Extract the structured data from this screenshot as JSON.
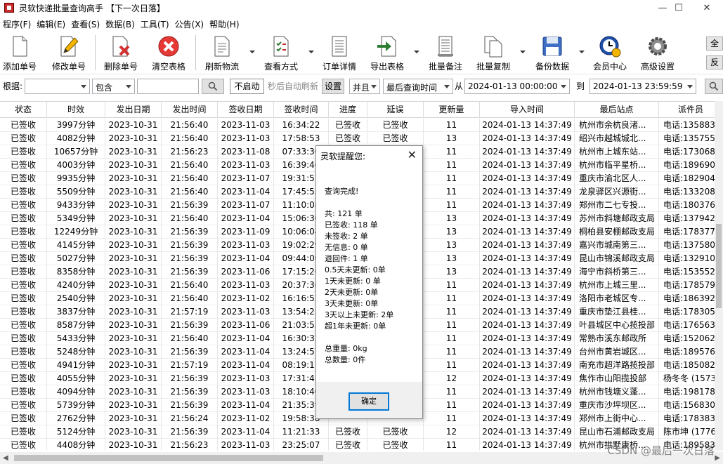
{
  "window": {
    "title": "灵软快递批量查询高手 【下一次日落】",
    "controls": [
      "—",
      "☐",
      "✕"
    ]
  },
  "menu": [
    "程序(F)",
    "编辑(E)",
    "查看(S)",
    "数据(B)",
    "工具(T)",
    "公告(X)",
    "帮助(H)"
  ],
  "toolbar": {
    "buttons": [
      {
        "label": "添加单号",
        "icon": "add-document-icon"
      },
      {
        "label": "修改单号",
        "icon": "edit-pencil-icon"
      },
      {
        "label": "删除单号",
        "icon": "delete-document-icon"
      },
      {
        "label": "清空表格",
        "icon": "clear-red-x-icon"
      },
      {
        "label": "刷新物流",
        "icon": "refresh-document-icon"
      },
      {
        "label": "查看方式",
        "icon": "view-mode-icon"
      },
      {
        "label": "订单详情",
        "icon": "order-detail-icon"
      },
      {
        "label": "导出表格",
        "icon": "export-arrow-icon"
      },
      {
        "label": "批量备注",
        "icon": "batch-note-icon"
      },
      {
        "label": "批量复制",
        "icon": "batch-copy-icon"
      },
      {
        "label": "备份数据",
        "icon": "floppy-disk-icon"
      },
      {
        "label": "会员中心",
        "icon": "clock-user-icon"
      },
      {
        "label": "高级设置",
        "icon": "gear-icon"
      }
    ],
    "side_buttons": [
      "全选",
      "反选"
    ]
  },
  "filter": {
    "label": "根据:",
    "field_value": "",
    "match_value": "包含",
    "search_value": "",
    "auto_refresh_button": "不启动",
    "auto_refresh_text": "秒后自动刷新",
    "settings_button": "设置",
    "logic_value": "并且",
    "time_field_value": "最后查询时间",
    "from_label": "从",
    "from_value": "2024-01-13 00:00:00",
    "to_label": "到",
    "to_value": "2024-01-13 23:59:59"
  },
  "table": {
    "columns": [
      "状态",
      "时效",
      "发出日期",
      "发出时间",
      "签收日期",
      "签收时间",
      "进度",
      "延误",
      "更新量",
      "导入时间",
      "最后站点",
      "派件员"
    ],
    "rows": [
      [
        "已签收",
        "3997分钟",
        "2023-10-31",
        "21:56:40",
        "2023-11-03",
        "16:34:22",
        "已签收",
        "已签收",
        "11",
        "2024-01-13 14:37:49",
        "杭州市余杭良渚...",
        "电话:1358836"
      ],
      [
        "已签收",
        "4082分钟",
        "2023-10-31",
        "21:56:40",
        "2023-11-03",
        "17:58:53",
        "已签收",
        "已签收",
        "13",
        "2024-01-13 14:37:49",
        "绍兴市越城城北...",
        "电话:1357558"
      ],
      [
        "已签收",
        "10657分钟",
        "2023-10-31",
        "21:56:23",
        "2023-11-08",
        "07:33:30",
        "",
        "",
        "11",
        "2024-01-13 14:37:49",
        "杭州市上城东站...",
        "电话:1730681"
      ],
      [
        "已签收",
        "4003分钟",
        "2023-10-31",
        "21:56:40",
        "2023-11-03",
        "16:39:46",
        "",
        "",
        "11",
        "2024-01-13 14:37:49",
        "杭州市临平星桥...",
        "电话:1896900"
      ],
      [
        "已签收",
        "9935分钟",
        "2023-10-31",
        "21:56:40",
        "2023-11-07",
        "19:31:57",
        "",
        "",
        "11",
        "2024-01-13 14:37:49",
        "重庆市渝北区人...",
        "电话:1829046"
      ],
      [
        "已签收",
        "5509分钟",
        "2023-10-31",
        "21:56:40",
        "2023-11-04",
        "17:45:55",
        "",
        "",
        "11",
        "2024-01-13 14:37:49",
        "龙泉驿区兴源街...",
        "电话:1332084"
      ],
      [
        "已签收",
        "9433分钟",
        "2023-10-31",
        "21:56:39",
        "2023-11-07",
        "11:10:08",
        "",
        "",
        "11",
        "2024-01-13 14:37:49",
        "郑州市二七专投...",
        "电话:1803768"
      ],
      [
        "已签收",
        "5349分钟",
        "2023-10-31",
        "21:56:40",
        "2023-11-04",
        "15:06:30",
        "",
        "",
        "13",
        "2024-01-13 14:37:49",
        "苏州市斜塘邮政支局",
        "电话:1379427"
      ],
      [
        "已签收",
        "12249分钟",
        "2023-10-31",
        "21:56:39",
        "2023-11-09",
        "10:06:04",
        "",
        "",
        "13",
        "2024-01-13 14:37:49",
        "桐柏县安棚邮政支局",
        "电话:1783775"
      ],
      [
        "已签收",
        "4145分钟",
        "2023-10-31",
        "21:56:39",
        "2023-11-03",
        "19:02:29",
        "",
        "",
        "13",
        "2024-01-13 14:37:49",
        "嘉兴市城南第三...",
        "电话:1375807"
      ],
      [
        "已签收",
        "5027分钟",
        "2023-10-31",
        "21:56:39",
        "2023-11-04",
        "09:44:00",
        "",
        "",
        "13",
        "2024-01-13 14:37:49",
        "昆山市锦溪邮政支局",
        "电话:1329109"
      ],
      [
        "已签收",
        "8358分钟",
        "2023-10-31",
        "21:56:39",
        "2023-11-06",
        "17:15:26",
        "",
        "",
        "13",
        "2024-01-13 14:37:49",
        "海宁市斜桥第三...",
        "电话:1535520"
      ],
      [
        "已签收",
        "4240分钟",
        "2023-10-31",
        "21:56:40",
        "2023-11-03",
        "20:37:36",
        "",
        "",
        "11",
        "2024-01-13 14:37:49",
        "杭州市上城三里...",
        "电话:1785790"
      ],
      [
        "已签收",
        "2540分钟",
        "2023-10-31",
        "21:56:40",
        "2023-11-02",
        "16:16:52",
        "",
        "",
        "11",
        "2024-01-13 14:37:49",
        "洛阳市老城区专...",
        "电话:1863929"
      ],
      [
        "已签收",
        "3837分钟",
        "2023-10-31",
        "21:57:19",
        "2023-11-03",
        "13:54:23",
        "",
        "",
        "11",
        "2024-01-13 14:37:49",
        "重庆市垫江县桂...",
        "电话:1783053"
      ],
      [
        "已签收",
        "8587分钟",
        "2023-10-31",
        "21:56:39",
        "2023-11-06",
        "21:03:53",
        "",
        "",
        "11",
        "2024-01-13 14:37:49",
        "叶县城区中心揽投部",
        "电话:1765633"
      ],
      [
        "已签收",
        "5433分钟",
        "2023-10-31",
        "21:56:40",
        "2023-11-04",
        "16:30:32",
        "",
        "",
        "11",
        "2024-01-13 14:37:49",
        "常熟市溪东邮政所",
        "电话:1520623"
      ],
      [
        "已签收",
        "5248分钟",
        "2023-10-31",
        "21:56:39",
        "2023-11-04",
        "13:24:57",
        "",
        "",
        "11",
        "2024-01-13 14:37:49",
        "台州市黄岩城区...",
        "电话:1895762"
      ],
      [
        "已签收",
        "4941分钟",
        "2023-10-31",
        "21:57:19",
        "2023-11-04",
        "08:19:11",
        "",
        "",
        "11",
        "2024-01-13 14:37:49",
        "南充市超洋路揽投部",
        "电话:1850821"
      ],
      [
        "已签收",
        "4055分钟",
        "2023-10-31",
        "21:56:39",
        "2023-11-03",
        "17:31:43",
        "",
        "",
        "12",
        "2024-01-13 14:37:49",
        "焦作市山阳揽投部",
        "杨冬冬 (1573"
      ],
      [
        "已签收",
        "4094分钟",
        "2023-10-31",
        "21:56:39",
        "2023-11-03",
        "18:10:40",
        "",
        "",
        "11",
        "2024-01-13 14:37:49",
        "杭州市钱塘义蓬...",
        "电话:1981785"
      ],
      [
        "已签收",
        "5739分钟",
        "2023-10-31",
        "21:56:39",
        "2023-11-04",
        "21:35:39",
        "",
        "",
        "11",
        "2024-01-13 14:37:49",
        "重庆市沙坪坝区...",
        "电话:1568308"
      ],
      [
        "已签收",
        "2762分钟",
        "2023-10-31",
        "21:56:24",
        "2023-11-02",
        "19:58:38",
        "",
        "",
        "11",
        "2024-01-13 14:37:49",
        "郑州市上街中心...",
        "电话:1783831"
      ],
      [
        "已签收",
        "5124分钟",
        "2023-10-31",
        "21:56:39",
        "2023-11-04",
        "11:21:33",
        "已签收",
        "已签收",
        "12",
        "2024-01-13 14:37:49",
        "昆山市石浦邮政支局",
        "陈市坤 (1776"
      ],
      [
        "已签收",
        "4408分钟",
        "2023-10-31",
        "21:56:23",
        "2023-11-03",
        "23:25:07",
        "已签收",
        "已签收",
        "11",
        "2024-01-13 14:37:49",
        "杭州市拱墅康桥...",
        "电话:1895837"
      ]
    ]
  },
  "dialog": {
    "title": "灵软提醒您:",
    "lines": [
      "查询完成!",
      "",
      "共: 121 单",
      "已签收: 118 单",
      "未签收: 2 单",
      "无信息: 0 单",
      "退回件: 1 单",
      " 0.5天未更新: 0单",
      "1天未更新: 0 单",
      "2天未更新: 0单",
      "3天未更新: 0单",
      "3天以上未更新: 2单",
      "超1年未更新: 0单",
      "",
      "总重量: 0kg",
      "总数量: 0件"
    ],
    "ok_label": "确定"
  },
  "watermark": "CSDN @最后一次日落"
}
